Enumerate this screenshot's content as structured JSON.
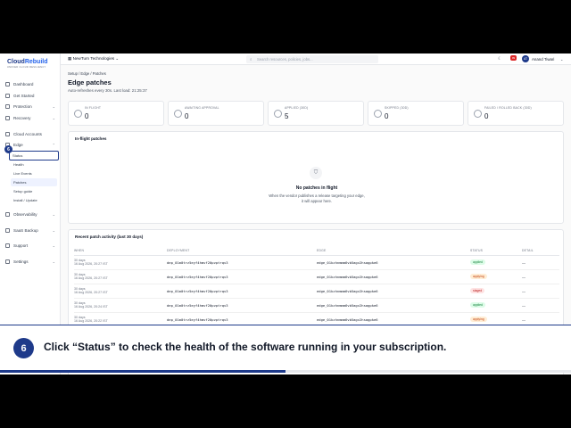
{
  "brand": {
    "name_a": "Cloud",
    "name_b": "Rebuild",
    "tagline": "UNIFIED CLOUD RESILIENCY"
  },
  "topbar": {
    "org": "NewTurn Technologies",
    "search_placeholder": "Search resources, policies, jobs...",
    "notifications": "99",
    "user_initials": "AT",
    "user_name": "Anand Tiwari"
  },
  "sidebar": {
    "items": [
      {
        "label": "Dashboard",
        "icon": "grid-icon"
      },
      {
        "label": "Get Started",
        "icon": "flag-icon"
      },
      {
        "label": "Protection",
        "icon": "shield-icon"
      },
      {
        "label": "Recovery",
        "icon": "refresh-icon"
      },
      {
        "label": "Cloud Accounts",
        "icon": "cloud-icon"
      },
      {
        "label": "Edge",
        "icon": "edge-icon"
      },
      {
        "label": "Observability",
        "icon": "eye-icon"
      },
      {
        "label": "SaaS Backup",
        "icon": "database-icon"
      },
      {
        "label": "Support",
        "icon": "help-icon"
      },
      {
        "label": "Settings",
        "icon": "gear-icon"
      }
    ],
    "edge_sub": [
      "Status",
      "Health",
      "Live Events",
      "Patches",
      "Setup guide",
      "Install / Update"
    ],
    "step_badge": "6"
  },
  "main": {
    "breadcrumb": "Setup  /  Edge  /  Patches",
    "title": "Edge patches",
    "subtitle": "Auto-refreshes every 30s. Last load: 21:25:37",
    "stats": [
      {
        "label": "IN FLIGHT",
        "value": "0"
      },
      {
        "label": "AWAITING APPROVAL",
        "value": "0"
      },
      {
        "label": "APPLIED (30D)",
        "value": "5"
      },
      {
        "label": "SKIPPED (30D)",
        "value": "0"
      },
      {
        "label": "FAILED / ROLLED BACK (30D)",
        "value": "0"
      }
    ],
    "inflight": {
      "title": "In-flight patches",
      "empty_title": "No patches in flight",
      "empty_line1": "When the vendor publishes a release targeting your edge,",
      "empty_line2": "it will appear here."
    },
    "recent": {
      "title": "Recent patch activity (last 30 days)",
      "columns": [
        "WHEN",
        "DEPLOYMENT",
        "EDGE",
        "STATUS",
        "DETAIL"
      ],
      "rows": [
        {
          "when_a": "30 days",
          "when_b": "16 Aug 2026, 20:27 IST",
          "deployment": "dep_01m0trz5eyf4hmvf20pvptrqv3",
          "edge": "edge_01kzhnmmm6vb5agv2hsagpke6",
          "status": "applied",
          "detail": "—"
        },
        {
          "when_a": "30 days",
          "when_b": "16 Aug 2026, 20:27 IST",
          "deployment": "dep_01m0trz5eyf4hmvf20pvptrqv3",
          "edge": "edge_01kzhnmmm6vb5agv2hsagpke6",
          "status": "applying",
          "detail": "—"
        },
        {
          "when_a": "30 days",
          "when_b": "16 Aug 2026, 20:27 IST",
          "deployment": "dep_01m0trz5eyf4hmvf20pvptrqv3",
          "edge": "edge_01kzhnmmm6vb5agv2hsagpke6",
          "status": "staged",
          "detail": "—"
        },
        {
          "when_a": "30 days",
          "when_b": "16 Aug 2026, 20:24 IST",
          "deployment": "dep_01m0trz5eyf4hmvf20pvptrqv3",
          "edge": "edge_01kzhnmmm6vb5agv2hsagpke6",
          "status": "applied",
          "detail": "—"
        },
        {
          "when_a": "30 days",
          "when_b": "16 Aug 2026, 20:22 IST",
          "deployment": "dep_01m0trz5eyf4hmvf20pvptrqv3",
          "edge": "edge_01kzhnmmm6vb5agv2hsagpke6",
          "status": "applying",
          "detail": "—"
        }
      ]
    }
  },
  "caption": {
    "step": "6",
    "text": "Click “Status” to check the health of the software running in your subscription.",
    "progress": 0.5
  },
  "colors": {
    "accent": "#1e3a8a",
    "applied": "#15803d",
    "applying": "#c2410c",
    "staged": "#b91c1c"
  }
}
